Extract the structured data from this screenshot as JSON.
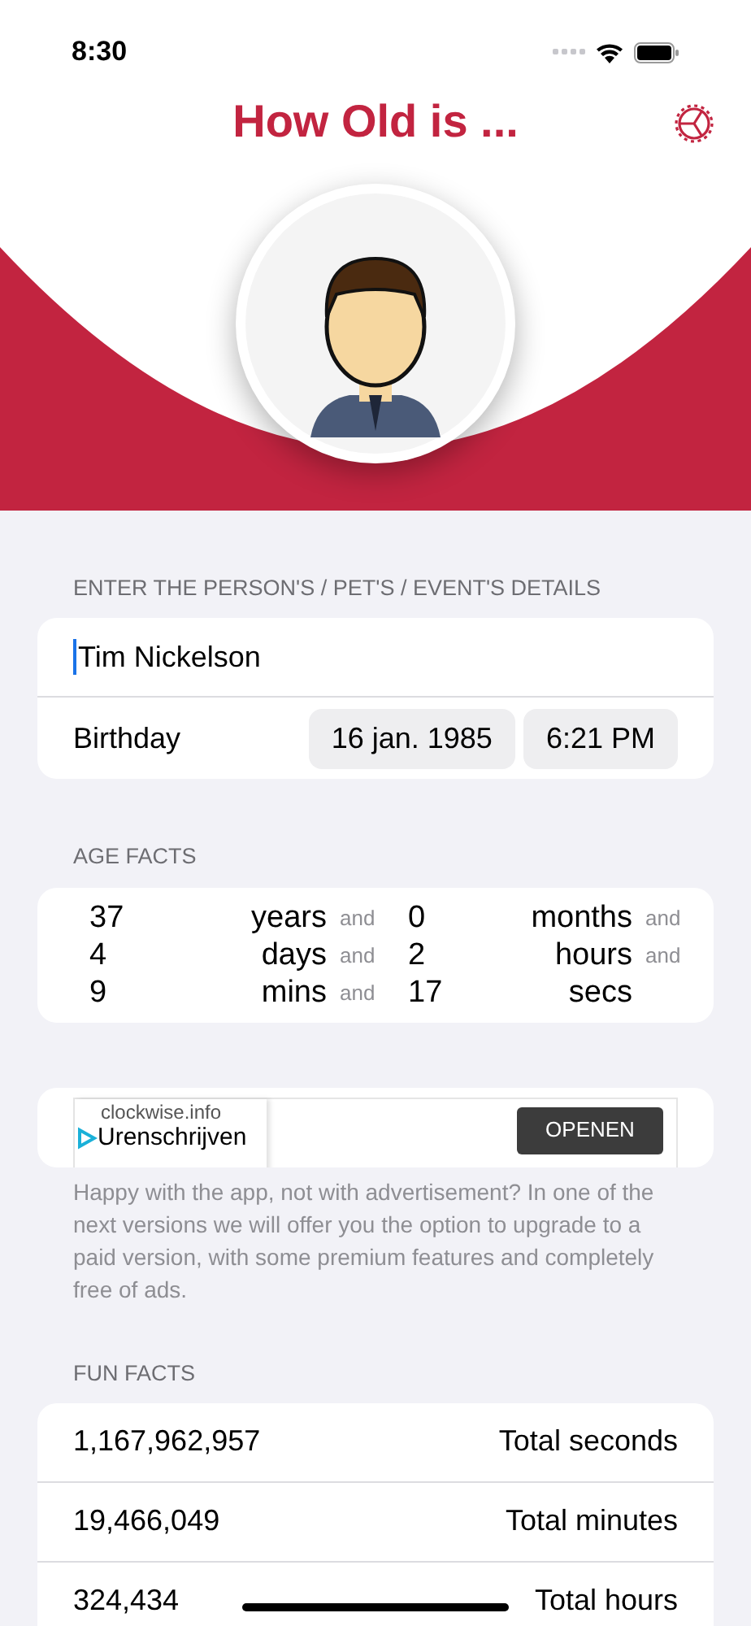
{
  "status_bar": {
    "time": "8:30"
  },
  "header": {
    "title": "How Old is ..."
  },
  "details": {
    "heading": "ENTER THE PERSON'S / PET'S / EVENT'S DETAILS",
    "name": {
      "value": "Tim Nickelson"
    },
    "birthday": {
      "label": "Birthday",
      "date": "16 jan. 1985",
      "time": "6:21 PM"
    }
  },
  "age_facts": {
    "heading": "AGE FACTS",
    "rows": [
      [
        {
          "value": "37",
          "unit": "years",
          "joiner": "and"
        },
        {
          "value": "0",
          "unit": "months",
          "joiner": "and"
        }
      ],
      [
        {
          "value": "4",
          "unit": "days",
          "joiner": "and"
        },
        {
          "value": "2",
          "unit": "hours",
          "joiner": "and"
        }
      ],
      [
        {
          "value": "9",
          "unit": "mins",
          "joiner": "and"
        },
        {
          "value": "17",
          "unit": "secs"
        }
      ]
    ]
  },
  "ad": {
    "domain": "clockwise.info",
    "headline": "Urenschrijven",
    "button": "OPENEN"
  },
  "ad_note": "Happy with the app, not with advertisement? In one of the next versions we will offer you the option to upgrade to a paid version, with some premium features and completely free of ads.",
  "fun_facts": {
    "heading": "FUN FACTS",
    "rows": [
      {
        "value": "1,167,962,957",
        "label": "Total seconds"
      },
      {
        "value": "19,466,049",
        "label": "Total minutes"
      },
      {
        "value": "324,434",
        "label": "Total hours"
      }
    ]
  }
}
